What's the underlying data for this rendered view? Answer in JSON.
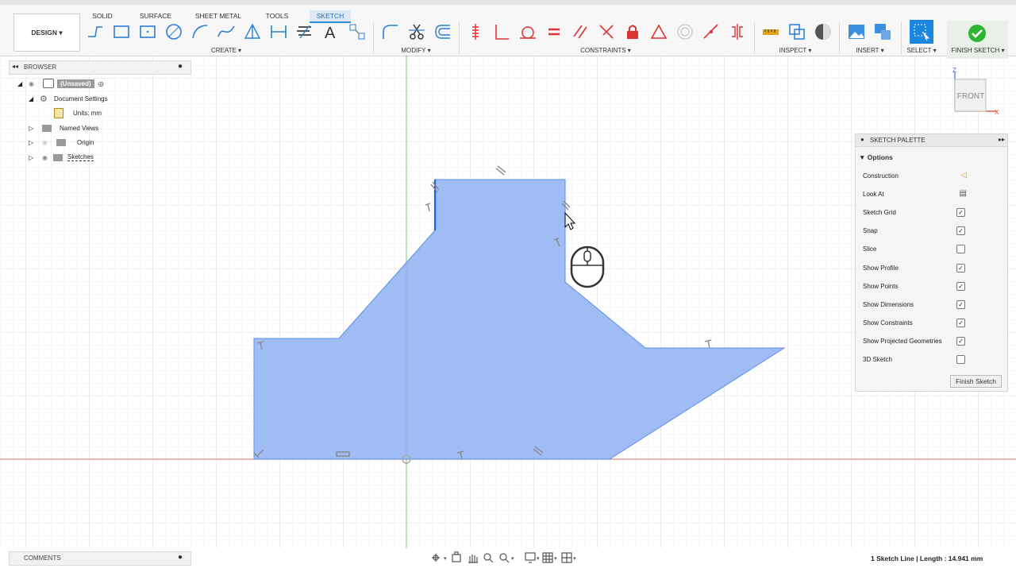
{
  "tabs": [
    "SOLID",
    "SURFACE",
    "SHEET METAL",
    "TOOLS",
    "SKETCH"
  ],
  "workspace": "DESIGN",
  "groups": {
    "create": "CREATE",
    "modify": "MODIFY",
    "constraints": "CONSTRAINTS",
    "inspect": "INSPECT",
    "insert": "INSERT",
    "select": "SELECT",
    "finish": "FINISH SKETCH"
  },
  "browser": {
    "title": "BROWSER",
    "items": [
      "(Unsaved)",
      "Document Settings",
      "Units: mm",
      "Named Views",
      "Origin",
      "Sketches"
    ]
  },
  "comments": "COMMENTS",
  "palette": {
    "title": "SKETCH PALETTE",
    "section": "Options",
    "rows": [
      {
        "label": "Construction",
        "type": "icon"
      },
      {
        "label": "Look At",
        "type": "icon"
      },
      {
        "label": "Sketch Grid",
        "type": "check",
        "checked": true
      },
      {
        "label": "Snap",
        "type": "check",
        "checked": true
      },
      {
        "label": "Slice",
        "type": "check",
        "checked": false
      },
      {
        "label": "Show Profile",
        "type": "check",
        "checked": true
      },
      {
        "label": "Show Points",
        "type": "check",
        "checked": true
      },
      {
        "label": "Show Dimensions",
        "type": "check",
        "checked": true
      },
      {
        "label": "Show Constraints",
        "type": "check",
        "checked": true
      },
      {
        "label": "Show Projected Geometries",
        "type": "check",
        "checked": true
      },
      {
        "label": "3D Sketch",
        "type": "check",
        "checked": false
      }
    ],
    "finish_button": "Finish Sketch"
  },
  "viewcube": {
    "face": "FRONT",
    "z_axis": "Z",
    "x_axis": "X"
  },
  "status": "1 Sketch Line | Length : 14.941 mm",
  "colors": {
    "accent": "#2a8bd6",
    "profile_fill": "#8fb0f2",
    "finish_green": "#2fb52f"
  }
}
